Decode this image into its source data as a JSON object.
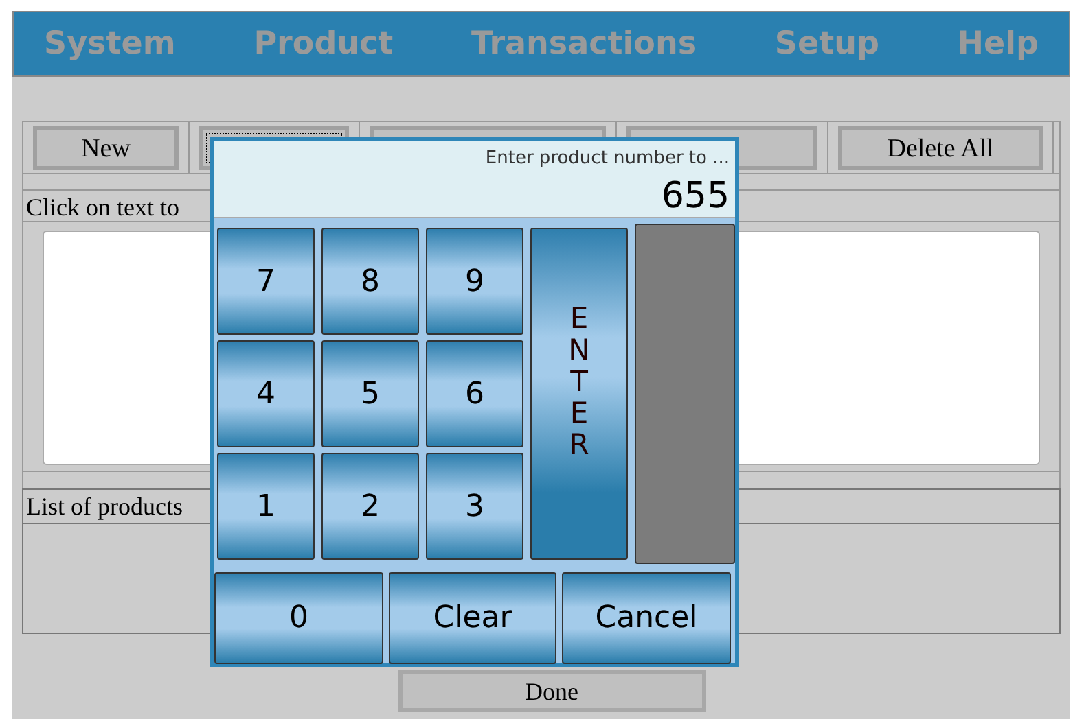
{
  "menu": [
    "System",
    "Product",
    "Transactions",
    "Setup",
    "Help"
  ],
  "toolbar": [
    {
      "kind": "button",
      "label": "New"
    },
    {
      "kind": "focused"
    },
    {
      "kind": "covered"
    },
    {
      "kind": "covered"
    },
    {
      "kind": "button",
      "label": "Delete All"
    }
  ],
  "text_label": "Click on text to",
  "list_label": "List of products",
  "done_button": "Done",
  "keypad": {
    "prompt": "Enter product number to ...",
    "value": "655",
    "digit_keys": [
      "7",
      "8",
      "9",
      "4",
      "5",
      "6",
      "1",
      "2",
      "3"
    ],
    "enter_key": "ENTER",
    "bottom_keys": [
      "0",
      "Clear",
      "Cancel"
    ]
  }
}
